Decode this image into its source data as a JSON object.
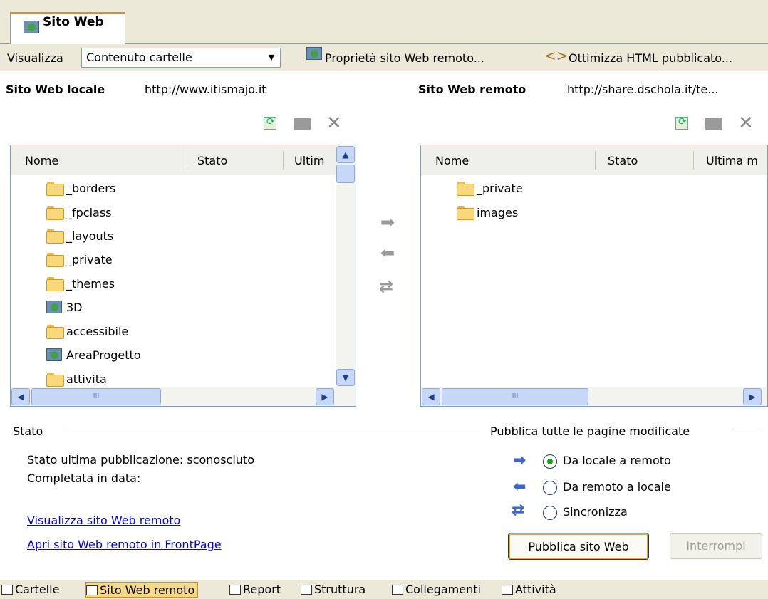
{
  "tab": {
    "title": "Sito Web"
  },
  "toolbar": {
    "view_label": "Visualizza",
    "view_value": "Contenuto cartelle",
    "remote_props": "Proprietà sito Web remoto...",
    "optimize": "Ottimizza HTML pubblicato..."
  },
  "local": {
    "label": "Sito Web locale",
    "url": "http://www.itismajo.it",
    "columns": [
      "Nome",
      "Stato",
      "Ultim"
    ],
    "items": [
      {
        "name": "_borders",
        "icon": "folder-icon"
      },
      {
        "name": "_fpclass",
        "icon": "folder-icon"
      },
      {
        "name": "_layouts",
        "icon": "folder-icon"
      },
      {
        "name": "_private",
        "icon": "folder-icon"
      },
      {
        "name": "_themes",
        "icon": "folder-icon"
      },
      {
        "name": "3D",
        "icon": "web-folder-icon"
      },
      {
        "name": "accessibile",
        "icon": "folder-icon"
      },
      {
        "name": "AreaProgetto",
        "icon": "web-folder-icon"
      },
      {
        "name": "attivita",
        "icon": "folder-icon"
      }
    ],
    "hscroll_thumb_label": "III"
  },
  "remote": {
    "label": "Sito Web remoto",
    "url": "http://share.dschola.it/te...",
    "columns": [
      "Nome",
      "Stato",
      "Ultima m"
    ],
    "items": [
      {
        "name": "_private",
        "icon": "folder-icon"
      },
      {
        "name": "images",
        "icon": "folder-icon"
      }
    ],
    "hscroll_thumb_label": "III"
  },
  "status": {
    "header": "Stato",
    "last_publish": "Stato ultima pubblicazione: sconosciuto",
    "completed": "Completata in data:",
    "link_view": "Visualizza sito Web remoto",
    "link_open": "Apri sito Web remoto in FrontPage"
  },
  "publish": {
    "header": "Pubblica tutte le pagine modificate",
    "options": [
      "Da locale a remoto",
      "Da remoto a locale",
      "Sincronizza"
    ],
    "selected": 0,
    "publish_button": "Pubblica sito Web",
    "stop_button": "Interrompi"
  },
  "viewbar": {
    "items": [
      "Cartelle",
      "Sito Web remoto",
      "Report",
      "Struttura",
      "Collegamenti",
      "Attività"
    ],
    "active": 1
  },
  "colors": {
    "chrome": "#ece9d8",
    "accent_orange": "#e68b2c",
    "link_blue": "#0000ee",
    "scroll_blue": "#c7d7f8"
  }
}
